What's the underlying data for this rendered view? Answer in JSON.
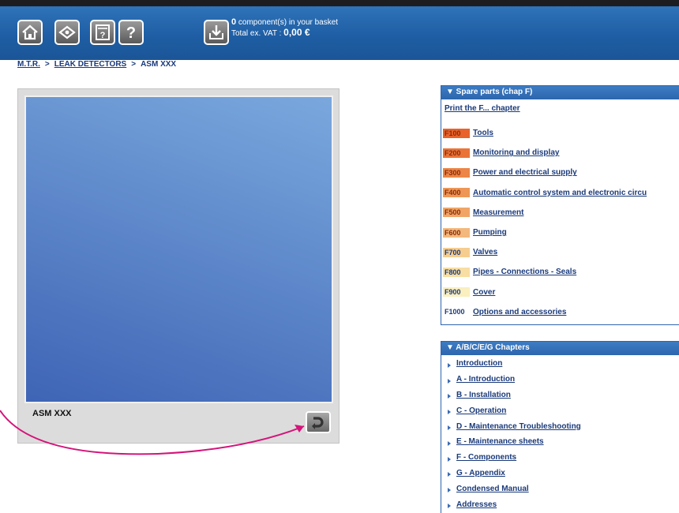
{
  "toolbar": {
    "icons": [
      "home-icon",
      "tag-icon",
      "document-icon",
      "help-icon",
      "download-icon"
    ],
    "basket_count": "0",
    "basket_text": "component(s) in your basket",
    "total_label": "Total ex. VAT :",
    "total_value": "0,00 €"
  },
  "breadcrumb": {
    "items": [
      "M.T.R.",
      "LEAK DETECTORS",
      "ASM XXX"
    ],
    "separator": ">"
  },
  "viewer": {
    "product_name": "ASM XXX",
    "image_color_top": "#7aa8dd",
    "image_color_bottom": "#3e64b5",
    "callout_color": "#d4147a"
  },
  "spare_parts": {
    "header": "▼ Spare parts (chap F)",
    "print_link": "Print the F... chapter",
    "items": [
      {
        "code": "F100",
        "label": "Tools",
        "color": "#e8622a"
      },
      {
        "code": "F200",
        "label": "Monitoring and display",
        "color": "#ea7438"
      },
      {
        "code": "F300",
        "label": "Power and electrical supply",
        "color": "#ec8546"
      },
      {
        "code": "F400",
        "label": "Automatic control system and electronic circu",
        "color": "#ee9656"
      },
      {
        "code": "F500",
        "label": "Measurement",
        "color": "#f0a566"
      },
      {
        "code": "F600",
        "label": "Pumping",
        "color": "#f3b87c"
      },
      {
        "code": "F700",
        "label": "Valves",
        "color": "#f6cd8e"
      },
      {
        "code": "F800",
        "label": "Pipes - Connections - Seals",
        "color": "#f8dea2"
      },
      {
        "code": "F900",
        "label": "Cover",
        "color": "#faefbf"
      },
      {
        "code": "F1000",
        "label": "Options and accessories",
        "color": "#ffffff"
      }
    ]
  },
  "chapters": {
    "header": "▼ A/B/C/E/G Chapters",
    "items": [
      "Introduction",
      "A - Introduction",
      "B - Installation",
      "C - Operation",
      "D - Maintenance Troubleshooting",
      "E - Maintenance sheets",
      "F - Components",
      "G - Appendix",
      "Condensed Manual",
      "Addresses"
    ]
  }
}
